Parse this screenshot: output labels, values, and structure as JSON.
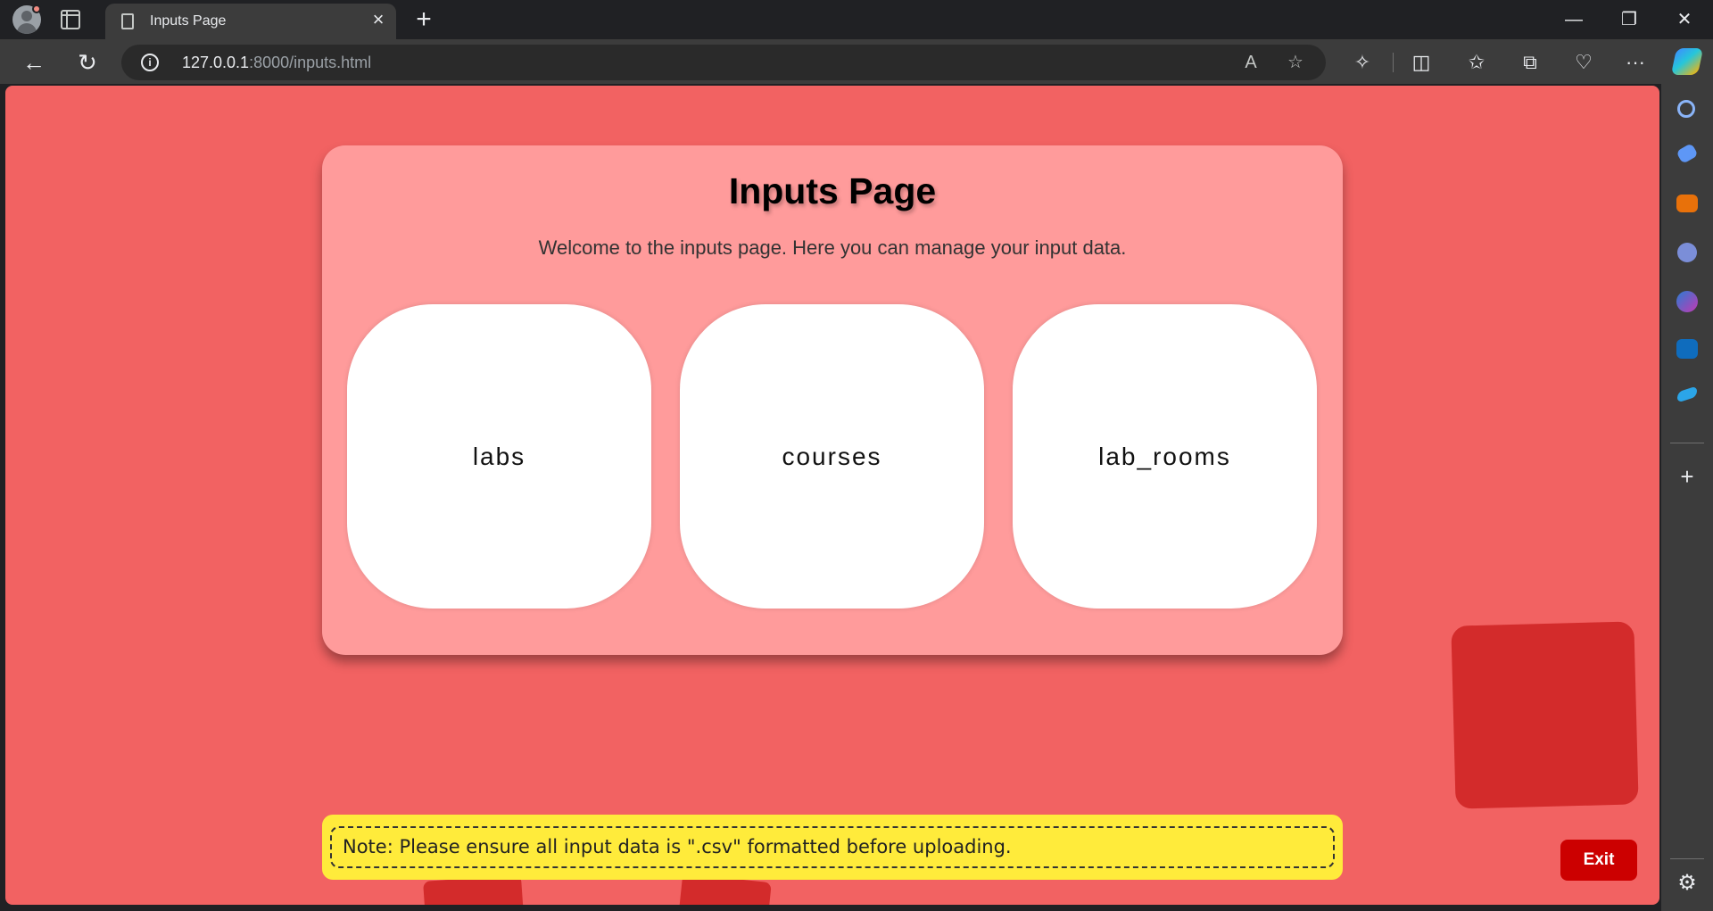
{
  "browser": {
    "tab_title": "Inputs Page",
    "tab_close": "×",
    "new_tab": "+",
    "url_host": "127.0.0.1",
    "url_rest": ":8000/inputs.html",
    "info_glyph": "i",
    "read_aloud_glyph": "A",
    "favorite_glyph": "☆",
    "more_glyph": "···",
    "window_controls": {
      "minimize": "—",
      "restore": "❐",
      "close": "✕"
    },
    "nav": {
      "back": "←",
      "refresh": "↻"
    }
  },
  "page": {
    "title": "Inputs Page",
    "welcome": "Welcome to the inputs page. Here you can manage your input data.",
    "tiles": [
      "labs",
      "courses",
      "lab_rooms"
    ],
    "note": "Note: Please ensure all input data is \".csv\" formatted before uploading.",
    "exit_label": "Exit"
  },
  "colors": {
    "page_background": "#f26262",
    "card_background": "#ff9b9b",
    "tile_background": "#ffffff",
    "note_background": "#ffeb3b",
    "exit_button": "#cc0000",
    "decoration": "#d32b2b"
  },
  "sidebar_icons": [
    "search-icon",
    "tag-icon",
    "briefcase-icon",
    "people-icon",
    "copilot-app-icon",
    "outlook-icon",
    "send-icon",
    "add-icon",
    "settings-icon"
  ]
}
